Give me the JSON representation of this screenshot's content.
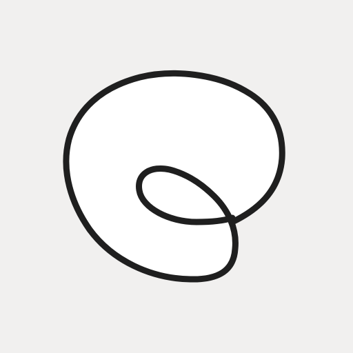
{
  "icon": {
    "name": "loop-swirl-logo-icon",
    "background_color": "#f1f0ef",
    "fill_color": "#ffffff",
    "stroke_color": "#1f1f1f"
  }
}
